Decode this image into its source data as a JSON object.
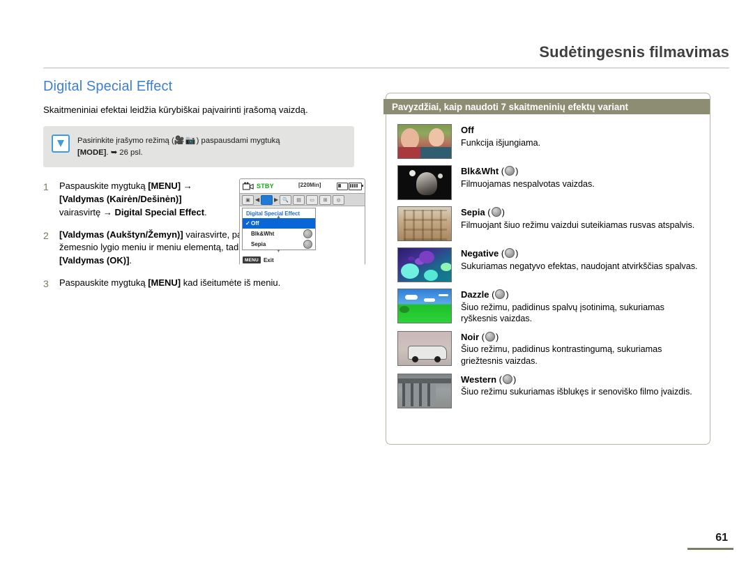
{
  "header": {
    "chapter_title": "Sudėtingesnis filmavimas"
  },
  "left": {
    "section_title": "Digital Special Effect",
    "intro": "Skaitmeniniai efektai leidžia kūrybiškai paįvairinti įrašomą vaizdą.",
    "note": {
      "icon": "check-badge-icon",
      "line1_before": "Pasirinkite įrašymo režimą (",
      "line1_after": ") paspausdami mygtuką",
      "line2_bold": "[MODE]",
      "line2_rest": ". ➥ 26 psl."
    },
    "steps": [
      {
        "num": "1",
        "parts": [
          {
            "t": "Paspauskite mygtuką ",
            "b": false
          },
          {
            "t": "[MENU]",
            "b": true
          },
          {
            "t": " → ",
            "b": false
          },
          {
            "t": "[Valdymas (Kairėn/Dešinėn)]",
            "b": true
          },
          {
            "t": " vairasvirtę → ",
            "b": false
          },
          {
            "t": "Digital Special Effect",
            "b": true
          },
          {
            "t": ".",
            "b": false
          }
        ]
      },
      {
        "num": "2",
        "parts": [
          {
            "t": "[Valdymas (Aukštyn/Žemyn)]",
            "b": true
          },
          {
            "t": " vairasvirte, pasirinkite pageidaujamą žemesnio lygio meniu ir meniu elementą, tada paspauskite mygtuką ",
            "b": false
          },
          {
            "t": "[Valdymas (OK)]",
            "b": true
          },
          {
            "t": ".",
            "b": false
          }
        ]
      },
      {
        "num": "3",
        "parts": [
          {
            "t": "Paspauskite mygtuką ",
            "b": false
          },
          {
            "t": "[MENU]",
            "b": true
          },
          {
            "t": " kad išeitumėte iš meniu.",
            "b": false
          }
        ]
      }
    ]
  },
  "lcd": {
    "status": "STBY",
    "time_remaining": "[220Min]",
    "menu_title": "Digital Special Effect",
    "rows": [
      {
        "label": "Off",
        "checked": true,
        "selected": true,
        "has_icon": false
      },
      {
        "label": "Blk&Wht",
        "checked": false,
        "selected": false,
        "has_icon": true
      },
      {
        "label": "Sepia",
        "checked": false,
        "selected": false,
        "has_icon": true
      }
    ],
    "exit_badge": "MENU",
    "exit_label": "Exit",
    "tab_icons": [
      "camera-icon",
      "palette-icon",
      "zoom-icon",
      "portrait-icon",
      "display-icon",
      "grid-icon",
      "settings-icon"
    ],
    "card_icon": "memory-card-icon",
    "battery_icon": "battery-icon"
  },
  "right": {
    "banner": "Pavyzdžiai, kaip naudoti 7 skaitmeninių efektų variant",
    "effects": [
      {
        "name": "Off",
        "has_icon": false,
        "desc": "Funkcija išjungiama.",
        "thumb": "children-photo-thumb",
        "thumb_class": "th-off"
      },
      {
        "name": "Blk&Wht",
        "has_icon": true,
        "desc": "Filmuojamas nespalvotas vaizdas.",
        "thumb": "black-white-portrait-thumb",
        "thumb_class": "th-bw"
      },
      {
        "name": "Sepia",
        "has_icon": true,
        "desc": "Filmuojant šiuo režimu vaizdui suteikiamas rusvas atspalvis.",
        "thumb": "sepia-building-thumb",
        "thumb_class": "th-sepia"
      },
      {
        "name": "Negative",
        "has_icon": true,
        "desc": "Sukuriamas negatyvo efektas, naudojant atvirkščias spalvas.",
        "thumb": "negative-flowers-thumb",
        "thumb_class": "th-neg"
      },
      {
        "name": "Dazzle",
        "has_icon": true,
        "desc": "Šiuo režimu, padidinus spalvų įsotinimą, sukuriamas ryškesnis vaizdas.",
        "thumb": "dazzle-landscape-thumb",
        "thumb_class": "th-dazzle"
      },
      {
        "name": "Noir",
        "has_icon": true,
        "desc": "Šiuo režimu, padidinus kontrastingumą, sukuriamas griežtesnis vaizdas.",
        "thumb": "noir-car-thumb",
        "thumb_class": "th-noir"
      },
      {
        "name": "Western",
        "has_icon": true,
        "desc": "Šiuo režimu sukuriamas išblukęs ir senoviško filmo įvaizdis.",
        "thumb": "western-street-thumb",
        "thumb_class": "th-west"
      }
    ]
  },
  "footer": {
    "page_number": "61"
  },
  "colors": {
    "accent_blue": "#3d7fd1",
    "banner_olive": "#8d8d73",
    "note_bg": "#e3e3e1",
    "menu_highlight": "#0a66d6",
    "stby_green": "#16a814"
  }
}
